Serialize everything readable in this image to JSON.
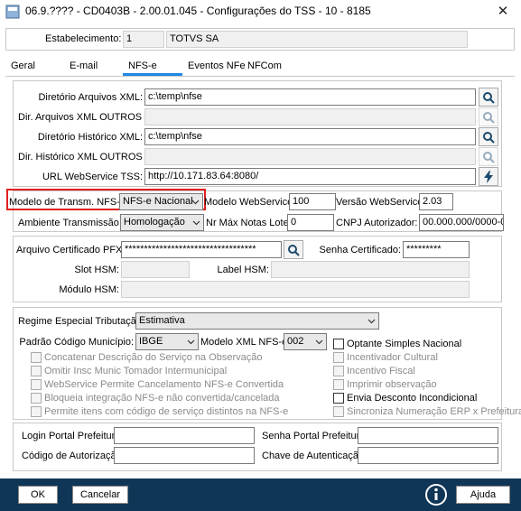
{
  "window": {
    "title": "06.9.???? - CD0403B - 2.00.01.045 - Configurações do TSS - 10 - 8185",
    "close_glyph": "✕"
  },
  "header": {
    "estabelecimento_label": "Estabelecimento:",
    "estabelecimento_code": "1",
    "estabelecimento_name": "TOTVS SA"
  },
  "tabs": [
    {
      "label": "Geral"
    },
    {
      "label": "E-mail"
    },
    {
      "label": "NFS-e"
    },
    {
      "label": "Eventos NFe"
    },
    {
      "label": "NFCom"
    }
  ],
  "active_tab": "NFS-e",
  "dirs": {
    "dir_xml_label": "Diretório Arquivos XML:",
    "dir_xml_value": "c:\\temp\\nfse",
    "dir_outros_label": "Dir. Arquivos XML OUTROS SO:",
    "dir_outros_value": "",
    "dir_hist_label": "Diretório Histórico XML:",
    "dir_hist_value": "c:\\temp\\nfse",
    "dir_hist_outros_label": "Dir. Histórico XML OUTROS SO:",
    "dir_hist_outros_value": "",
    "url_label": "URL WebService TSS:",
    "url_value": "http://10.171.83.64:8080/"
  },
  "transm": {
    "modelo_label": "Modelo de Transm. NFS-e:",
    "modelo_value": "NFS-e Nacional",
    "modelo_ws_label": "Modelo WebService:",
    "modelo_ws_value": "100",
    "versao_label": "Versão WebService:",
    "versao_value": "2.03",
    "ambiente_label": "Ambiente Transmissão:",
    "ambiente_value": "Homologação",
    "nr_max_label": "Nr Máx Notas Lote:",
    "nr_max_value": "0",
    "cnpj_label": "CNPJ Autorizador:",
    "cnpj_value": "00.000.000/0000-00"
  },
  "cert": {
    "arquivo_label": "Arquivo Certificado PFX:",
    "arquivo_value": "**********************************",
    "senha_label": "Senha Certificado:",
    "senha_value": "*********",
    "slot_label": "Slot HSM:",
    "label_hsm_label": "Label HSM:",
    "modulo_label": "Módulo HSM:"
  },
  "regime": {
    "regime_label": "Regime Especial Tributação:",
    "regime_value": "Estimativa",
    "padrao_label": "Padrão Código Município:",
    "padrao_value": "IBGE",
    "modelo_xml_label": "Modelo XML NFS-e:",
    "modelo_xml_value": "002"
  },
  "checks_left": [
    {
      "label": "Concatenar Descrição do Serviço na Observação"
    },
    {
      "label": "Omitir Insc Munic Tomador Intermunicipal"
    },
    {
      "label": "WebService Permite Cancelamento NFS-e Convertida"
    },
    {
      "label": "Bloqueia integração NFS-e não convertida/cancelada"
    },
    {
      "label": "Permite itens com código de serviço distintos na NFS-e"
    }
  ],
  "checks_right": [
    {
      "label": "Optante Simples Nacional",
      "enabled": true
    },
    {
      "label": "Incentivador Cultural",
      "enabled": false
    },
    {
      "label": "Incentivo Fiscal",
      "enabled": false
    },
    {
      "label": "Imprimir observação",
      "enabled": false
    },
    {
      "label": "Envia Desconto Incondicional",
      "enabled": true
    },
    {
      "label": "Sincroniza Numeração ERP x Prefeitura",
      "enabled": false
    }
  ],
  "prefeitura": {
    "login_label": "Login Portal Prefeitura:",
    "senha_label": "Senha Portal Prefeitura:",
    "codigo_label": "Código de Autorização:",
    "chave_label": "Chave de Autenticação:"
  },
  "buttons": {
    "ok": "OK",
    "cancelar": "Cancelar",
    "ajuda": "Ajuda"
  },
  "colors": {
    "bottombar": "#0f3656",
    "tab_underline": "#1e88e5",
    "highlight": "#e02020"
  }
}
